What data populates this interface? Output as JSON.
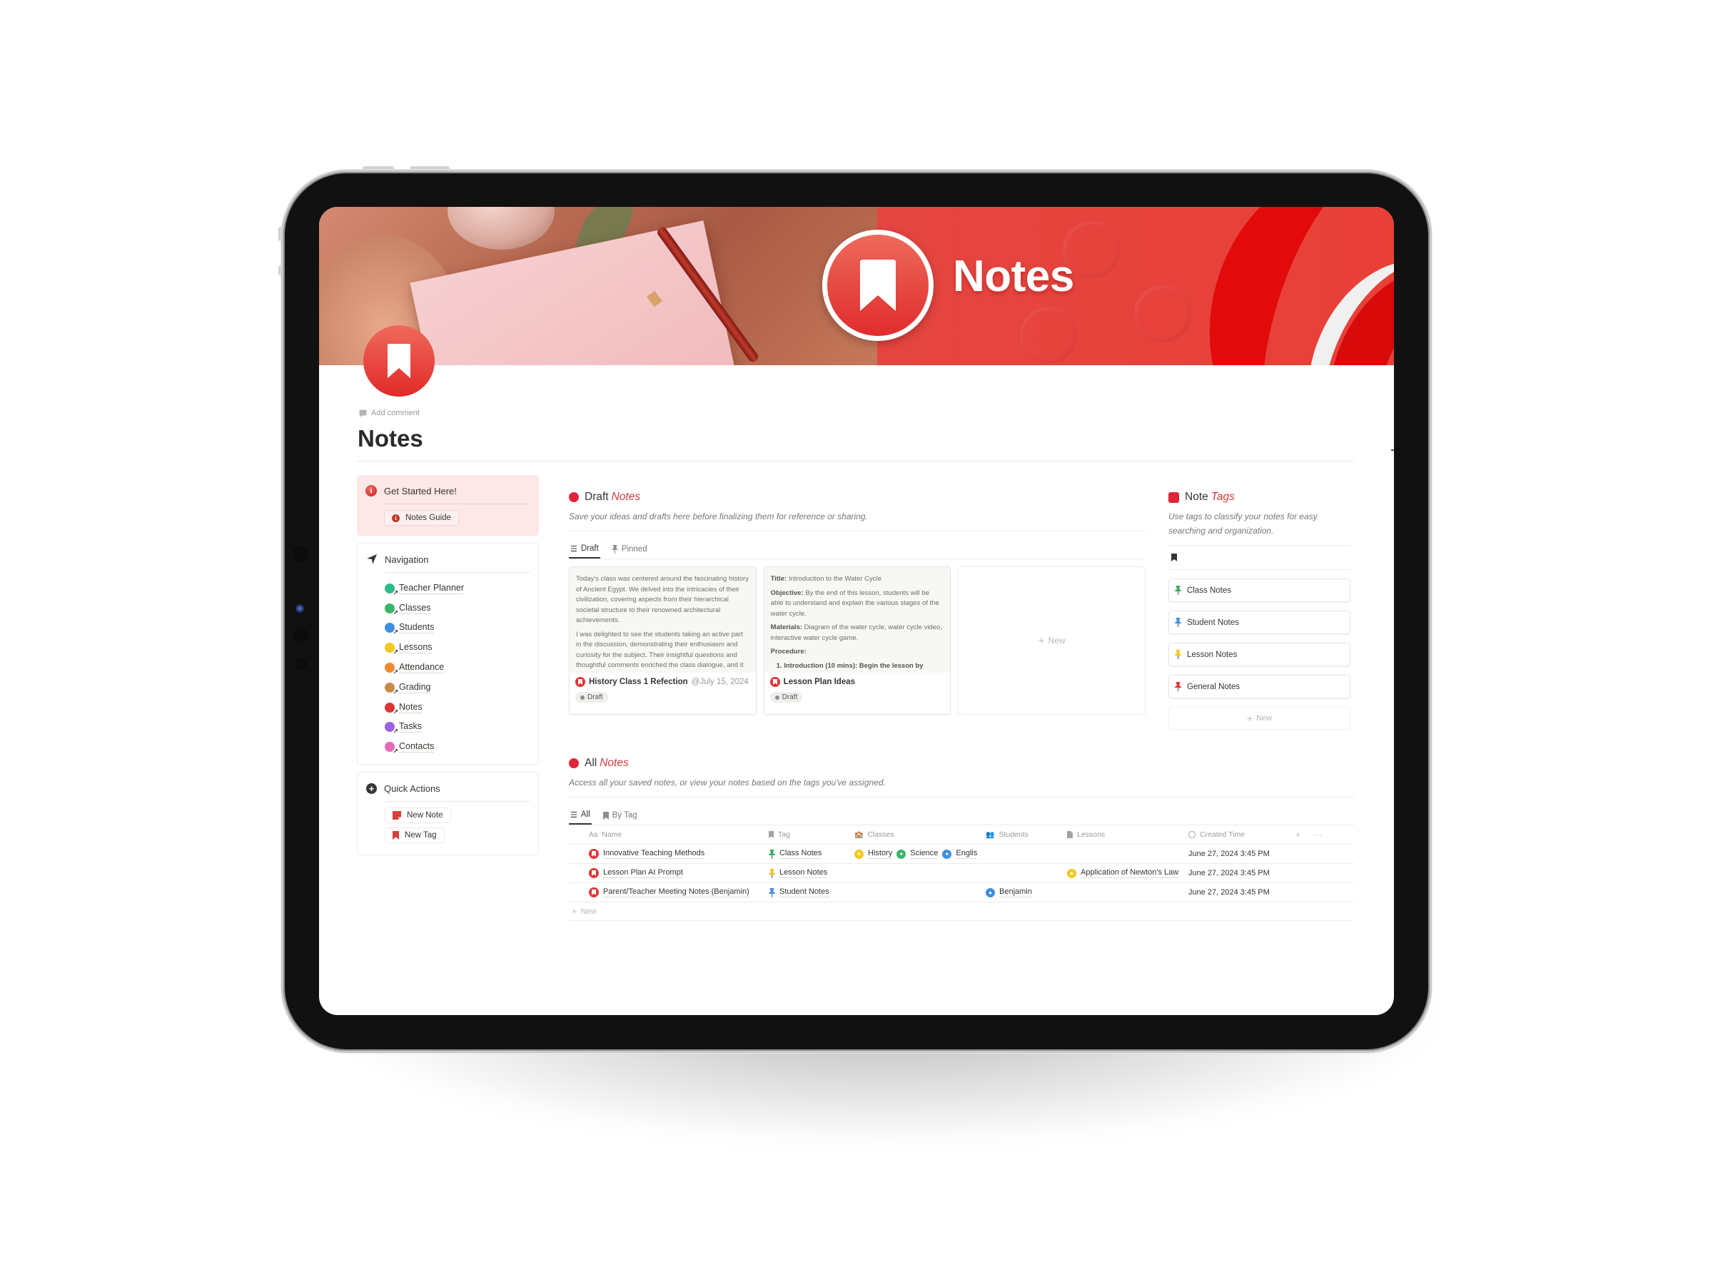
{
  "cover": {
    "banner_title": "Notes",
    "colors": {
      "brand_red": "#e54540",
      "accent_red": "#e0263a",
      "ribbon_red": "#e20a0a"
    }
  },
  "page": {
    "add_comment": "Add comment",
    "title": "Notes",
    "page_icon": "bookmark-icon"
  },
  "get_started": {
    "heading": "Get Started Here!",
    "icon": "info-icon",
    "guide_button": "Notes Guide"
  },
  "navigation": {
    "heading": "Navigation",
    "icon": "location-arrow-icon",
    "items": [
      {
        "label": "Teacher Planner",
        "color": "#2fb88a"
      },
      {
        "label": "Classes",
        "color": "#3bb56a"
      },
      {
        "label": "Students",
        "color": "#3e8fe0"
      },
      {
        "label": "Lessons",
        "color": "#f2c81e"
      },
      {
        "label": "Attendance",
        "color": "#f08a32"
      },
      {
        "label": "Grading",
        "color": "#c98a4a"
      },
      {
        "label": "Notes",
        "color": "#e13333"
      },
      {
        "label": "Tasks",
        "color": "#9a63e6"
      },
      {
        "label": "Contacts",
        "color": "#e46ab8"
      }
    ]
  },
  "quick_actions": {
    "heading": "Quick Actions",
    "icon": "plus-circle-icon",
    "buttons": [
      {
        "label": "New Note",
        "icon": "sticky-note-icon"
      },
      {
        "label": "New Tag",
        "icon": "bookmark-icon"
      }
    ]
  },
  "draft_notes": {
    "title_plain": "Draft",
    "title_accent": "Notes",
    "description": "Save your ideas and drafts here before finalizing them for reference or sharing.",
    "tabs": [
      {
        "label": "Draft",
        "active": true,
        "icon": "draft-lines-icon"
      },
      {
        "label": "Pinned",
        "active": false,
        "icon": "pin-icon"
      }
    ],
    "cards": [
      {
        "preview": [
          "Today's class was centered around the fascinating history of Ancient Egypt. We delved into the intricacies of their civilization, covering aspects from their hierarchical societal structure to their renowned architectural achievements.",
          "I was delighted to see the students taking an active part in the discussion, demonstrating their enthusiasm and curiosity for the subject. Their insightful questions and thoughtful comments enriched the class dialogue, and it"
        ],
        "title": "History Class 1 Refection",
        "date": "@July 15, 2024",
        "status": "Draft"
      },
      {
        "preview_structured": {
          "title_label": "Title:",
          "title_value": "Introduction to the Water Cycle",
          "objective_label": "Objective:",
          "objective_value": "By the end of this lesson, students will be able to understand and explain the various stages of the water cycle.",
          "materials_label": "Materials:",
          "materials_value": "Diagram of the water cycle, water cycle video, interactive water cycle game.",
          "procedure_label": "Procedure:",
          "procedure_item": "1.  Introduction (10 mins): Begin the lesson by"
        },
        "title": "Lesson Plan Ideas",
        "status": "Draft"
      }
    ],
    "new_label": "New"
  },
  "note_tags": {
    "title_plain": "Note",
    "title_accent": "Tags",
    "description": "Use tags to classify your notes for easy searching and organization.",
    "tags": [
      {
        "label": "Class Notes",
        "pin_color": "#3daa5c"
      },
      {
        "label": "Student Notes",
        "pin_color": "#3e8fe0"
      },
      {
        "label": "Lesson Notes",
        "pin_color": "#f2c81e"
      },
      {
        "label": "General Notes",
        "pin_color": "#e13333"
      }
    ],
    "new_label": "New"
  },
  "all_notes": {
    "title_plain": "All",
    "title_accent": "Notes",
    "description": "Access all your saved notes, or view your notes based on the tags you've assigned.",
    "tabs": [
      {
        "label": "All",
        "active": true,
        "icon": "list-icon"
      },
      {
        "label": "By Tag",
        "active": false,
        "icon": "bookmark-icon"
      }
    ],
    "columns": {
      "name": "Name",
      "tag": "Tag",
      "classes": "Classes",
      "students": "Students",
      "lessons": "Lessons",
      "created": "Created Time"
    },
    "rows": [
      {
        "name": "Innovative Teaching Methods",
        "tag": "Class Notes",
        "tag_color": "#3daa5c",
        "classes": [
          {
            "label": "History",
            "color": "#f2c81e"
          },
          {
            "label": "Science",
            "color": "#3bb56a"
          },
          {
            "label": "Englis",
            "color": "#3e8fe0"
          }
        ],
        "students": "",
        "lessons": "",
        "created": "June 27, 2024 3:45 PM"
      },
      {
        "name": "Lesson Plan AI Prompt",
        "tag": "Lesson Notes",
        "tag_color": "#f2c81e",
        "classes": [],
        "students": "",
        "lessons": "Application of Newton's Law",
        "created": "June 27, 2024 3:45 PM"
      },
      {
        "name": "Parent/Teacher Meeting Notes (Benjamin)",
        "tag": "Student Notes",
        "tag_color": "#3e8fe0",
        "classes": [],
        "students": "Benjamin",
        "lessons": "",
        "created": "June 27, 2024 3:45 PM"
      }
    ],
    "new_label": "New",
    "add_column": "+",
    "more": "···"
  }
}
